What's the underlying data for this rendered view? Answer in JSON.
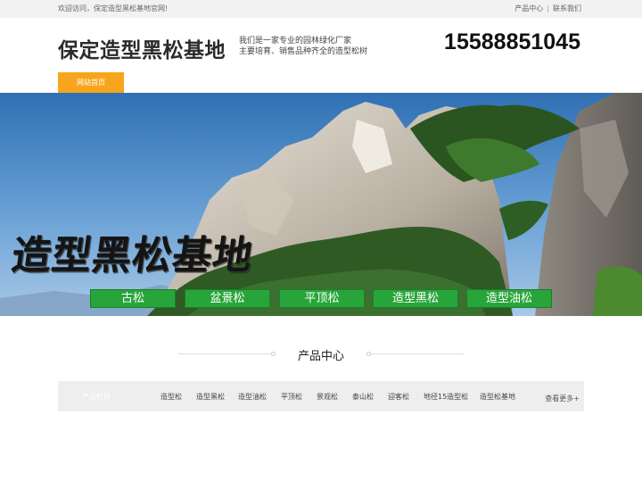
{
  "topbar": {
    "welcome": "欢迎访问，保定造型黑松基地官网!",
    "link_products": "产品中心",
    "separator": "|",
    "link_contact": "联系我们"
  },
  "header": {
    "brand": "保定造型黑松基地",
    "slogan_line1": "我们是一家专业的园林绿化厂家",
    "slogan_line2": "主要培育、销售品种齐全的造型松树",
    "phone": "15588851045"
  },
  "nav": {
    "home": "网站首页"
  },
  "banner": {
    "title": "造型黑松基地",
    "tags": [
      "古松",
      "盆景松",
      "平顶松",
      "造型黑松",
      "造型油松"
    ]
  },
  "products": {
    "section_title": "产品中心",
    "category_head": "产品栏目",
    "categories": [
      "造型松",
      "造型黑松",
      "造型油松",
      "平顶松",
      "景观松",
      "泰山松",
      "迎客松",
      "地径15造型松",
      "造型松基地"
    ],
    "more": "查看更多+"
  },
  "colors": {
    "accent": "#f7a51c",
    "tag_green": "#28a53a",
    "topbar_bg": "#f2f2f2"
  }
}
